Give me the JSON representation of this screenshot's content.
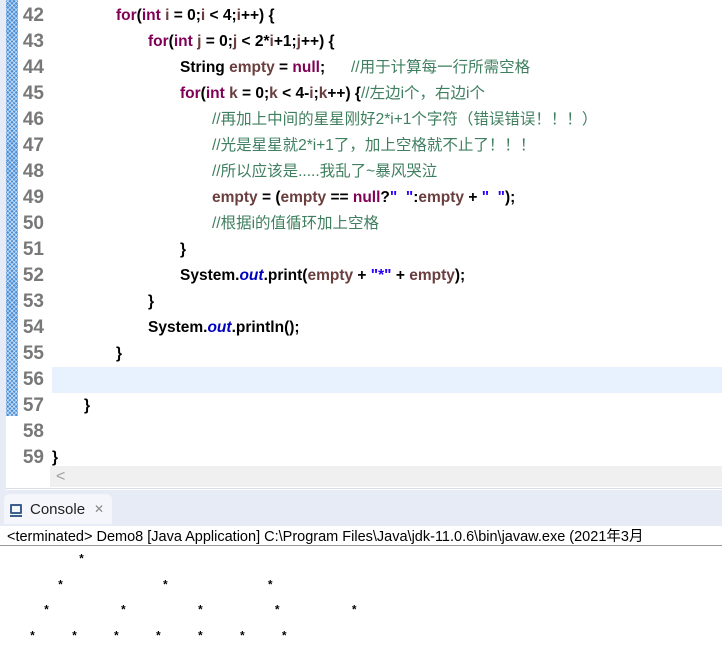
{
  "editor": {
    "line_numbers": [
      "42",
      "43",
      "44",
      "45",
      "46",
      "47",
      "48",
      "49",
      "50",
      "51",
      "52",
      "53",
      "54",
      "55",
      "56",
      "57",
      "58",
      "59"
    ],
    "current_line": "56",
    "lines": [
      [
        [
          "plain",
          "\t\t"
        ],
        [
          "kw",
          "for"
        ],
        [
          "plain",
          "("
        ],
        [
          "kw",
          "int"
        ],
        [
          "plain",
          " "
        ],
        [
          "var",
          "i"
        ],
        [
          "plain",
          " = 0;"
        ],
        [
          "var",
          "i"
        ],
        [
          "plain",
          " < 4;"
        ],
        [
          "var",
          "i"
        ],
        [
          "plain",
          "++) {"
        ]
      ],
      [
        [
          "plain",
          "\t\t\t"
        ],
        [
          "kw",
          "for"
        ],
        [
          "plain",
          "("
        ],
        [
          "kw",
          "int"
        ],
        [
          "plain",
          " "
        ],
        [
          "var",
          "j"
        ],
        [
          "plain",
          " = 0;"
        ],
        [
          "var",
          "j"
        ],
        [
          "plain",
          " < 2*"
        ],
        [
          "var",
          "i"
        ],
        [
          "plain",
          "+1;"
        ],
        [
          "var",
          "j"
        ],
        [
          "plain",
          "++) {"
        ]
      ],
      [
        [
          "plain",
          "\t\t\t\t"
        ],
        [
          "plain",
          "String "
        ],
        [
          "var",
          "empty"
        ],
        [
          "plain",
          " = "
        ],
        [
          "kw",
          "null"
        ],
        [
          "plain",
          ";      "
        ],
        [
          "cm",
          "//用于计算每一行所需空格"
        ]
      ],
      [
        [
          "plain",
          "\t\t\t\t"
        ],
        [
          "kw",
          "for"
        ],
        [
          "plain",
          "("
        ],
        [
          "kw",
          "int"
        ],
        [
          "plain",
          " "
        ],
        [
          "var",
          "k"
        ],
        [
          "plain",
          " = 0;"
        ],
        [
          "var",
          "k"
        ],
        [
          "plain",
          " < 4-"
        ],
        [
          "var",
          "i"
        ],
        [
          "plain",
          ";"
        ],
        [
          "var",
          "k"
        ],
        [
          "plain",
          "++) {"
        ],
        [
          "cm",
          "//左边i个，右边i个"
        ]
      ],
      [
        [
          "plain",
          "\t\t\t\t\t"
        ],
        [
          "cm",
          "//再加上中间的星星刚好2*i+1个字符（错误错误！！！）"
        ]
      ],
      [
        [
          "plain",
          "\t\t\t\t\t"
        ],
        [
          "cm",
          "//光是星星就2*i+1了，加上空格就不止了！！！"
        ]
      ],
      [
        [
          "plain",
          "\t\t\t\t\t"
        ],
        [
          "cm",
          "//所以应该是.....我乱了~暴风哭泣"
        ]
      ],
      [
        [
          "plain",
          "\t\t\t\t\t"
        ],
        [
          "var",
          "empty"
        ],
        [
          "plain",
          " = ("
        ],
        [
          "var",
          "empty"
        ],
        [
          "plain",
          " == "
        ],
        [
          "kw",
          "null"
        ],
        [
          "plain",
          "?"
        ],
        [
          "str",
          "\"  \""
        ],
        [
          "plain",
          ":"
        ],
        [
          "var",
          "empty"
        ],
        [
          "plain",
          " + "
        ],
        [
          "str",
          "\"  \""
        ],
        [
          "plain",
          ");"
        ]
      ],
      [
        [
          "plain",
          "\t\t\t\t\t"
        ],
        [
          "cm",
          "//根据i的值循环加上空格"
        ]
      ],
      [
        [
          "plain",
          "\t\t\t\t"
        ],
        [
          "plain",
          "}"
        ]
      ],
      [
        [
          "plain",
          "\t\t\t\t"
        ],
        [
          "plain",
          "System."
        ],
        [
          "fld",
          "out"
        ],
        [
          "plain",
          ".print("
        ],
        [
          "var",
          "empty"
        ],
        [
          "plain",
          " + "
        ],
        [
          "str",
          "\"*\""
        ],
        [
          "plain",
          " + "
        ],
        [
          "var",
          "empty"
        ],
        [
          "plain",
          ");"
        ]
      ],
      [
        [
          "plain",
          "\t\t\t"
        ],
        [
          "plain",
          "}"
        ]
      ],
      [
        [
          "plain",
          "\t\t\t"
        ],
        [
          "plain",
          "System."
        ],
        [
          "fld",
          "out"
        ],
        [
          "plain",
          ".println();"
        ]
      ],
      [
        [
          "plain",
          "\t\t"
        ],
        [
          "plain",
          "}"
        ]
      ],
      [],
      [
        [
          "plain",
          "\t"
        ],
        [
          "plain",
          "}"
        ]
      ],
      [],
      [
        [
          "plain",
          "}"
        ]
      ]
    ],
    "scroll_left_glyph": "<"
  },
  "console": {
    "tab_label": "Console",
    "close_glyph": "✕",
    "status": "<terminated> Demo8 [Java Application] C:\\Program Files\\Java\\jdk-11.0.6\\bin\\javaw.exe (2021年3月",
    "output": [
      "          *",
      "       *              *              *",
      "     *          *          *          *          *",
      "   *     *     *     *     *     *     *"
    ]
  },
  "colors": {
    "keyword": "#7f0055",
    "variable": "#6a3e3e",
    "comment": "#3f7f5f",
    "string": "#2a00ff",
    "field": "#0000c0",
    "current_line": "#e8f2fe"
  }
}
